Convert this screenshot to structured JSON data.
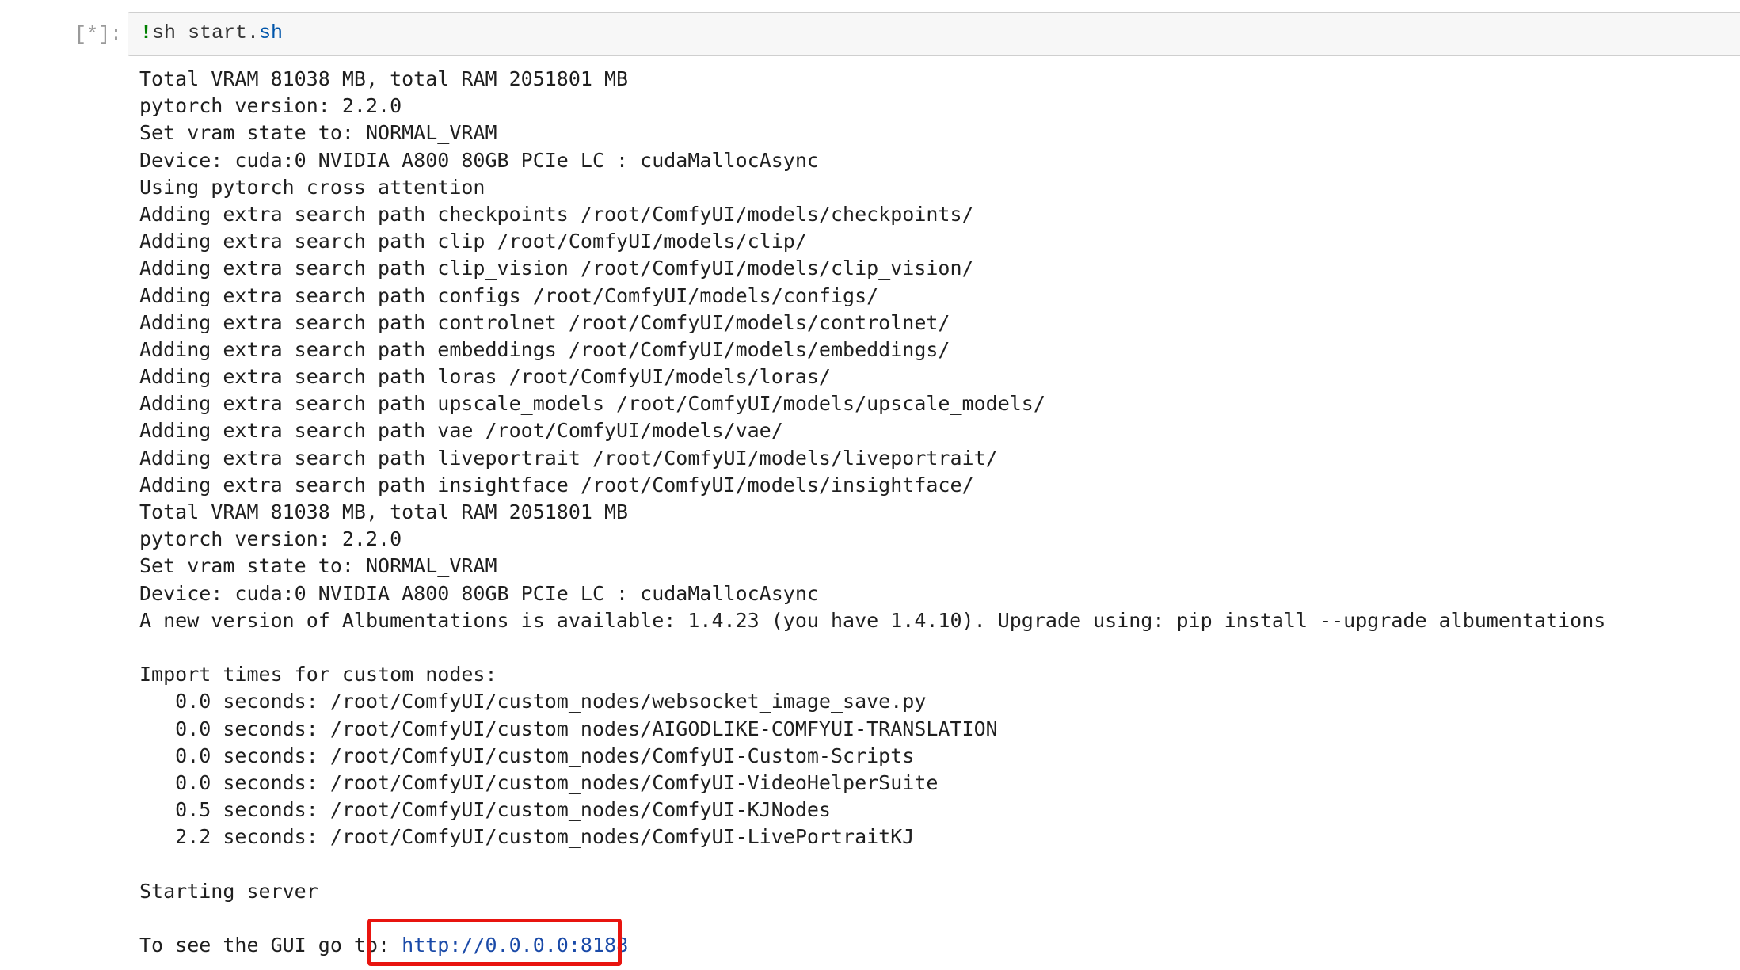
{
  "cell": {
    "prompt": "[*]:",
    "command": {
      "bang": "!",
      "cmd": "sh start.",
      "ext": "sh"
    }
  },
  "output": {
    "lines": [
      "Total VRAM 81038 MB, total RAM 2051801 MB",
      "pytorch version: 2.2.0",
      "Set vram state to: NORMAL_VRAM",
      "Device: cuda:0 NVIDIA A800 80GB PCIe LC : cudaMallocAsync",
      "Using pytorch cross attention",
      "Adding extra search path checkpoints /root/ComfyUI/models/checkpoints/",
      "Adding extra search path clip /root/ComfyUI/models/clip/",
      "Adding extra search path clip_vision /root/ComfyUI/models/clip_vision/",
      "Adding extra search path configs /root/ComfyUI/models/configs/",
      "Adding extra search path controlnet /root/ComfyUI/models/controlnet/",
      "Adding extra search path embeddings /root/ComfyUI/models/embeddings/",
      "Adding extra search path loras /root/ComfyUI/models/loras/",
      "Adding extra search path upscale_models /root/ComfyUI/models/upscale_models/",
      "Adding extra search path vae /root/ComfyUI/models/vae/",
      "Adding extra search path liveportrait /root/ComfyUI/models/liveportrait/",
      "Adding extra search path insightface /root/ComfyUI/models/insightface/",
      "Total VRAM 81038 MB, total RAM 2051801 MB",
      "pytorch version: 2.2.0",
      "Set vram state to: NORMAL_VRAM",
      "Device: cuda:0 NVIDIA A800 80GB PCIe LC : cudaMallocAsync",
      "A new version of Albumentations is available: 1.4.23 (you have 1.4.10). Upgrade using: pip install --upgrade albumentations",
      "",
      "Import times for custom nodes:",
      "   0.0 seconds: /root/ComfyUI/custom_nodes/websocket_image_save.py",
      "   0.0 seconds: /root/ComfyUI/custom_nodes/AIGODLIKE-COMFYUI-TRANSLATION",
      "   0.0 seconds: /root/ComfyUI/custom_nodes/ComfyUI-Custom-Scripts",
      "   0.0 seconds: /root/ComfyUI/custom_nodes/ComfyUI-VideoHelperSuite",
      "   0.5 seconds: /root/ComfyUI/custom_nodes/ComfyUI-KJNodes",
      "   2.2 seconds: /root/ComfyUI/custom_nodes/ComfyUI-LivePortraitKJ",
      "",
      "Starting server",
      ""
    ],
    "gui_prefix": "To see the GUI go to: ",
    "gui_url": "http://0.0.0.0:8188"
  },
  "colors": {
    "highlight_box": "#e8140f",
    "link": "#1a4aa8",
    "prompt": "#9a9a9a"
  }
}
